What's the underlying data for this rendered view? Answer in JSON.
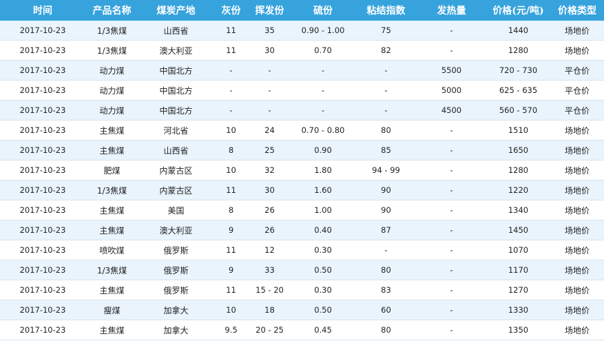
{
  "table": {
    "headers": [
      "时间",
      "产品名称",
      "煤炭产地",
      "灰份",
      "挥发份",
      "硫份",
      "粘结指数",
      "发热量",
      "价格(元/吨)",
      "价格类型"
    ],
    "rows": [
      [
        "2017-10-23",
        "1/3焦煤",
        "山西省",
        "11",
        "35",
        "0.90 - 1.00",
        "75",
        "-",
        "1440",
        "场地价"
      ],
      [
        "2017-10-23",
        "1/3焦煤",
        "澳大利亚",
        "11",
        "30",
        "0.70",
        "82",
        "-",
        "1280",
        "场地价"
      ],
      [
        "2017-10-23",
        "动力煤",
        "中国北方",
        "-",
        "-",
        "-",
        "-",
        "5500",
        "720 - 730",
        "平仓价"
      ],
      [
        "2017-10-23",
        "动力煤",
        "中国北方",
        "-",
        "-",
        "-",
        "-",
        "5000",
        "625 - 635",
        "平仓价"
      ],
      [
        "2017-10-23",
        "动力煤",
        "中国北方",
        "-",
        "-",
        "-",
        "-",
        "4500",
        "560 - 570",
        "平仓价"
      ],
      [
        "2017-10-23",
        "主焦煤",
        "河北省",
        "10",
        "24",
        "0.70 - 0.80",
        "80",
        "-",
        "1510",
        "场地价"
      ],
      [
        "2017-10-23",
        "主焦煤",
        "山西省",
        "8",
        "25",
        "0.90",
        "85",
        "-",
        "1650",
        "场地价"
      ],
      [
        "2017-10-23",
        "肥煤",
        "内蒙古区",
        "10",
        "32",
        "1.80",
        "94 - 99",
        "-",
        "1280",
        "场地价"
      ],
      [
        "2017-10-23",
        "1/3焦煤",
        "内蒙古区",
        "11",
        "30",
        "1.60",
        "90",
        "-",
        "1220",
        "场地价"
      ],
      [
        "2017-10-23",
        "主焦煤",
        "美国",
        "8",
        "26",
        "1.00",
        "90",
        "-",
        "1340",
        "场地价"
      ],
      [
        "2017-10-23",
        "主焦煤",
        "澳大利亚",
        "9",
        "26",
        "0.40",
        "87",
        "-",
        "1450",
        "场地价"
      ],
      [
        "2017-10-23",
        "喷吹煤",
        "俄罗斯",
        "11",
        "12",
        "0.30",
        "-",
        "-",
        "1070",
        "场地价"
      ],
      [
        "2017-10-23",
        "1/3焦煤",
        "俄罗斯",
        "9",
        "33",
        "0.50",
        "80",
        "-",
        "1170",
        "场地价"
      ],
      [
        "2017-10-23",
        "主焦煤",
        "俄罗斯",
        "11",
        "15 - 20",
        "0.30",
        "83",
        "-",
        "1270",
        "场地价"
      ],
      [
        "2017-10-23",
        "瘦煤",
        "加拿大",
        "10",
        "18",
        "0.50",
        "60",
        "-",
        "1330",
        "场地价"
      ],
      [
        "2017-10-23",
        "主焦煤",
        "加拿大",
        "9.5",
        "20 - 25",
        "0.45",
        "80",
        "-",
        "1350",
        "场地价"
      ]
    ]
  },
  "colors": {
    "header_bg": "#36a3dd",
    "header_text": "#ffffff",
    "row_alt_bg": "#e9f4fc",
    "row_bg": "#ffffff"
  }
}
